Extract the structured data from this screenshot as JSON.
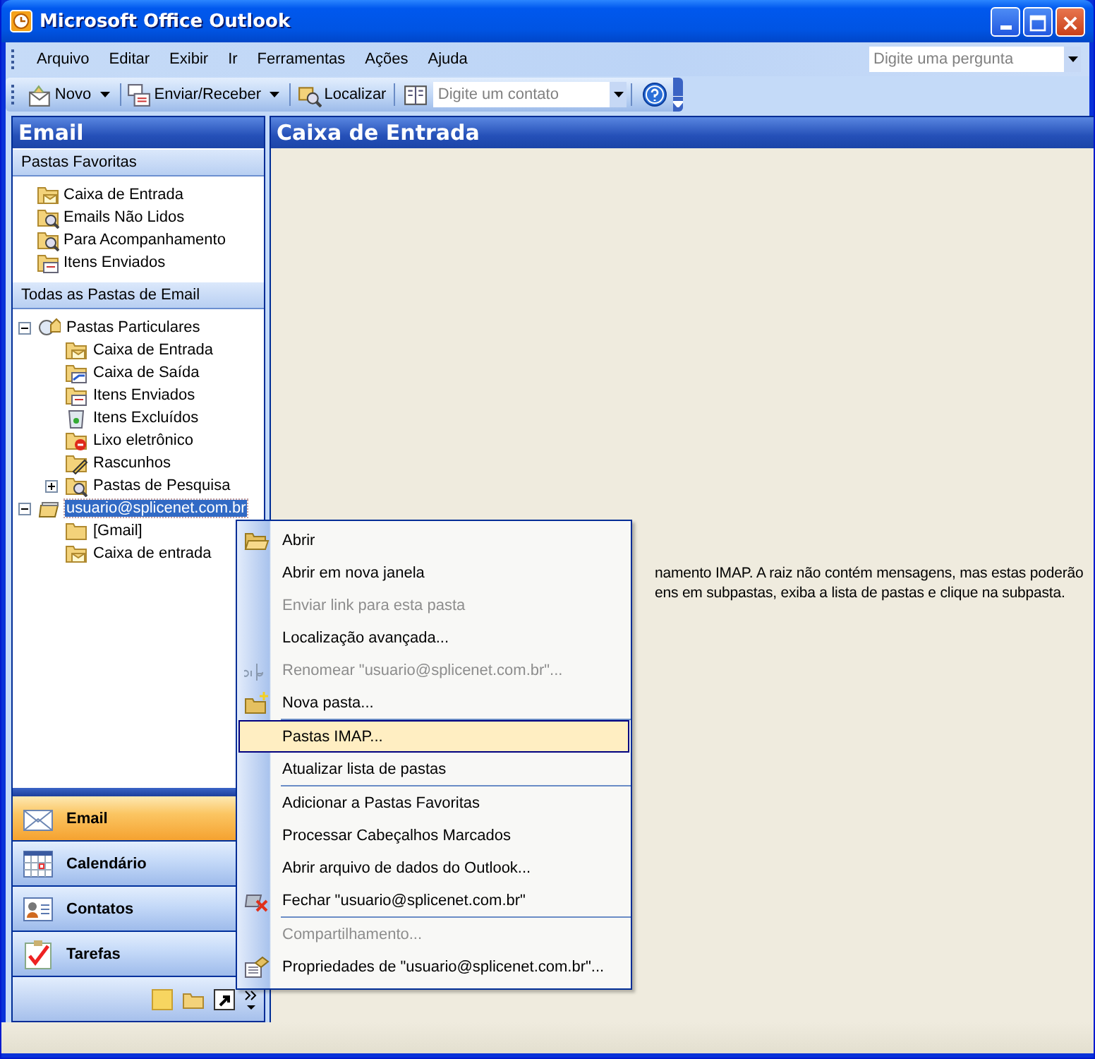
{
  "window": {
    "title": "Microsoft Office Outlook"
  },
  "menu_bar": [
    "Arquivo",
    "Editar",
    "Exibir",
    "Ir",
    "Ferramentas",
    "Ações",
    "Ajuda"
  ],
  "question_box": {
    "placeholder": "Digite uma pergunta"
  },
  "toolbar": [
    {
      "kind": "split",
      "label": "Novo"
    },
    {
      "kind": "split",
      "label": "Enviar/Receber"
    },
    {
      "kind": "find",
      "label": "Localizar"
    },
    {
      "kind": "contact",
      "placeholder": "Digite um contato"
    },
    {
      "kind": "help"
    }
  ],
  "navigation_pane": {
    "title": "Email",
    "favorites": {
      "header": "Pastas Favoritas",
      "items": [
        {
          "label": "Caixa de Entrada",
          "kind": "inbox"
        },
        {
          "label": "Emails Não Lidos",
          "kind": "search"
        },
        {
          "label": "Para Acompanhamento",
          "kind": "search"
        },
        {
          "label": "Itens Enviados",
          "kind": "sent"
        }
      ]
    },
    "all_folders": {
      "header": "Todas as Pastas de Email",
      "tree": [
        {
          "label": "Pastas Particulares",
          "kind": "home",
          "expanded": true,
          "selected": false,
          "children": [
            {
              "label": "Caixa de Entrada",
              "kind": "inbox",
              "selected": false
            },
            {
              "label": "Caixa de Saída",
              "kind": "outbox",
              "selected": false
            },
            {
              "label": "Itens Enviados",
              "kind": "sent",
              "selected": false
            },
            {
              "label": "Itens Excluídos",
              "kind": "deleted",
              "selected": false
            },
            {
              "label": "Lixo eletrônico",
              "kind": "junk",
              "selected": false
            },
            {
              "label": "Rascunhos",
              "kind": "drafts",
              "selected": false
            },
            {
              "label": "Pastas de Pesquisa",
              "kind": "search",
              "expanded": false,
              "selected": false
            }
          ]
        },
        {
          "label": "usuario@splicenet.com.br",
          "kind": "account",
          "expanded": true,
          "selected": true,
          "children": [
            {
              "label": "[Gmail]",
              "kind": "plain",
              "selected": false
            },
            {
              "label": "Caixa de entrada",
              "kind": "inbox",
              "selected": false
            }
          ]
        }
      ]
    },
    "buttons": [
      {
        "label": "Email",
        "kind": "mail",
        "selected": true
      },
      {
        "label": "Calendário",
        "kind": "calendar",
        "selected": false
      },
      {
        "label": "Contatos",
        "kind": "contacts",
        "selected": false
      },
      {
        "label": "Tarefas",
        "kind": "tasks",
        "selected": false
      }
    ]
  },
  "reading_pane": {
    "title": "Caixa de Entrada",
    "message": [
      "namento IMAP. A raiz não contém mensagens, mas estas poderão",
      "ens em subpastas, exiba a lista de pastas e clique na subpasta."
    ]
  },
  "context_menu": [
    {
      "label": "Abrir",
      "kind": "open",
      "disabled": false,
      "selected": false
    },
    {
      "label": "Abrir em nova janela",
      "disabled": false,
      "selected": false
    },
    {
      "label": "Enviar link para esta pasta",
      "disabled": true,
      "selected": false
    },
    {
      "label": "Localização avançada...",
      "disabled": false,
      "selected": false
    },
    {
      "label": "Renomear \"usuario@splicenet.com.br\"...",
      "kind": "rename",
      "disabled": true,
      "selected": false
    },
    {
      "label": "Nova pasta...",
      "kind": "newfolder",
      "disabled": false,
      "selected": false
    },
    {
      "label": "Pastas IMAP...",
      "separator": true,
      "disabled": false,
      "selected": true
    },
    {
      "label": "Atualizar lista de pastas",
      "disabled": false,
      "selected": false
    },
    {
      "label": "Adicionar a Pastas Favoritas",
      "separator": true,
      "disabled": false,
      "selected": false
    },
    {
      "label": "Processar Cabeçalhos Marcados",
      "disabled": false,
      "selected": false
    },
    {
      "label": "Abrir arquivo de dados do Outlook...",
      "disabled": false,
      "selected": false
    },
    {
      "label": "Fechar \"usuario@splicenet.com.br\"",
      "kind": "close",
      "disabled": false,
      "selected": false
    },
    {
      "label": "Compartilhamento...",
      "separator": true,
      "disabled": true,
      "selected": false
    },
    {
      "label": "Propriedades de \"usuario@splicenet.com.br\"...",
      "kind": "properties",
      "disabled": false,
      "selected": false
    }
  ]
}
